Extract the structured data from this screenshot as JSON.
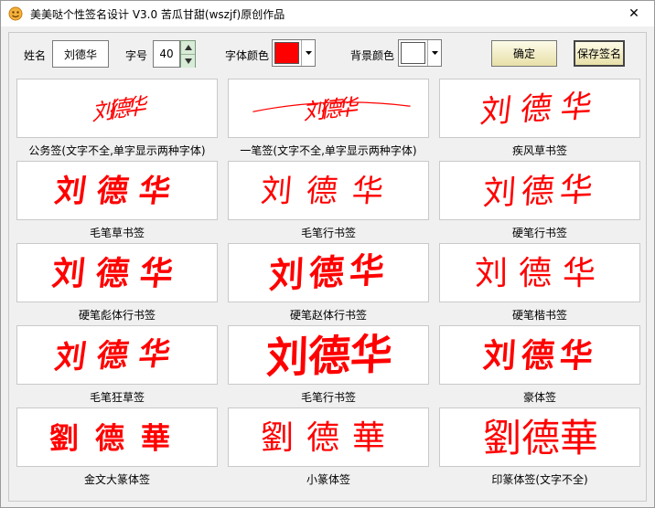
{
  "title_bar": {
    "title": "美美哒个性签名设计 V3.0     苦瓜甘甜(wszjf)原创作品",
    "close_label": "✕"
  },
  "toolbar": {
    "name_label": "姓名",
    "name_value": "刘德华",
    "size_label": "字号",
    "size_value": "40",
    "font_color_label": "字体颜色",
    "font_color": "#ff0000",
    "bg_color_label": "背景颜色",
    "bg_color": "#ffffff",
    "confirm_label": "确定",
    "save_label": "保存签名"
  },
  "signatures": [
    {
      "text": "刘德华",
      "caption": "公务签(文字不全,单字显示两种字体)"
    },
    {
      "text": "刘德华",
      "caption": "一笔签(文字不全,单字显示两种字体)"
    },
    {
      "text": "刘德华",
      "caption": "疾风草书签"
    },
    {
      "text": "刘德华",
      "caption": "毛笔草书签"
    },
    {
      "text": "刘德华",
      "caption": "毛笔行书签"
    },
    {
      "text": "刘德华",
      "caption": "硬笔行书签"
    },
    {
      "text": "刘德华",
      "caption": "硬笔彪体行书签"
    },
    {
      "text": "刘德华",
      "caption": "硬笔赵体行书签"
    },
    {
      "text": "刘德华",
      "caption": "硬笔楷书签"
    },
    {
      "text": "刘德华",
      "caption": "毛笔狂草签"
    },
    {
      "text": "刘德华",
      "caption": "毛笔行书签"
    },
    {
      "text": "刘德华",
      "caption": "豪体签"
    },
    {
      "text": "劉德華",
      "caption": "金文大篆体签"
    },
    {
      "text": "劉德華",
      "caption": "小篆体签"
    },
    {
      "text": "劉德華",
      "caption": "印篆体签(文字不全)"
    }
  ]
}
